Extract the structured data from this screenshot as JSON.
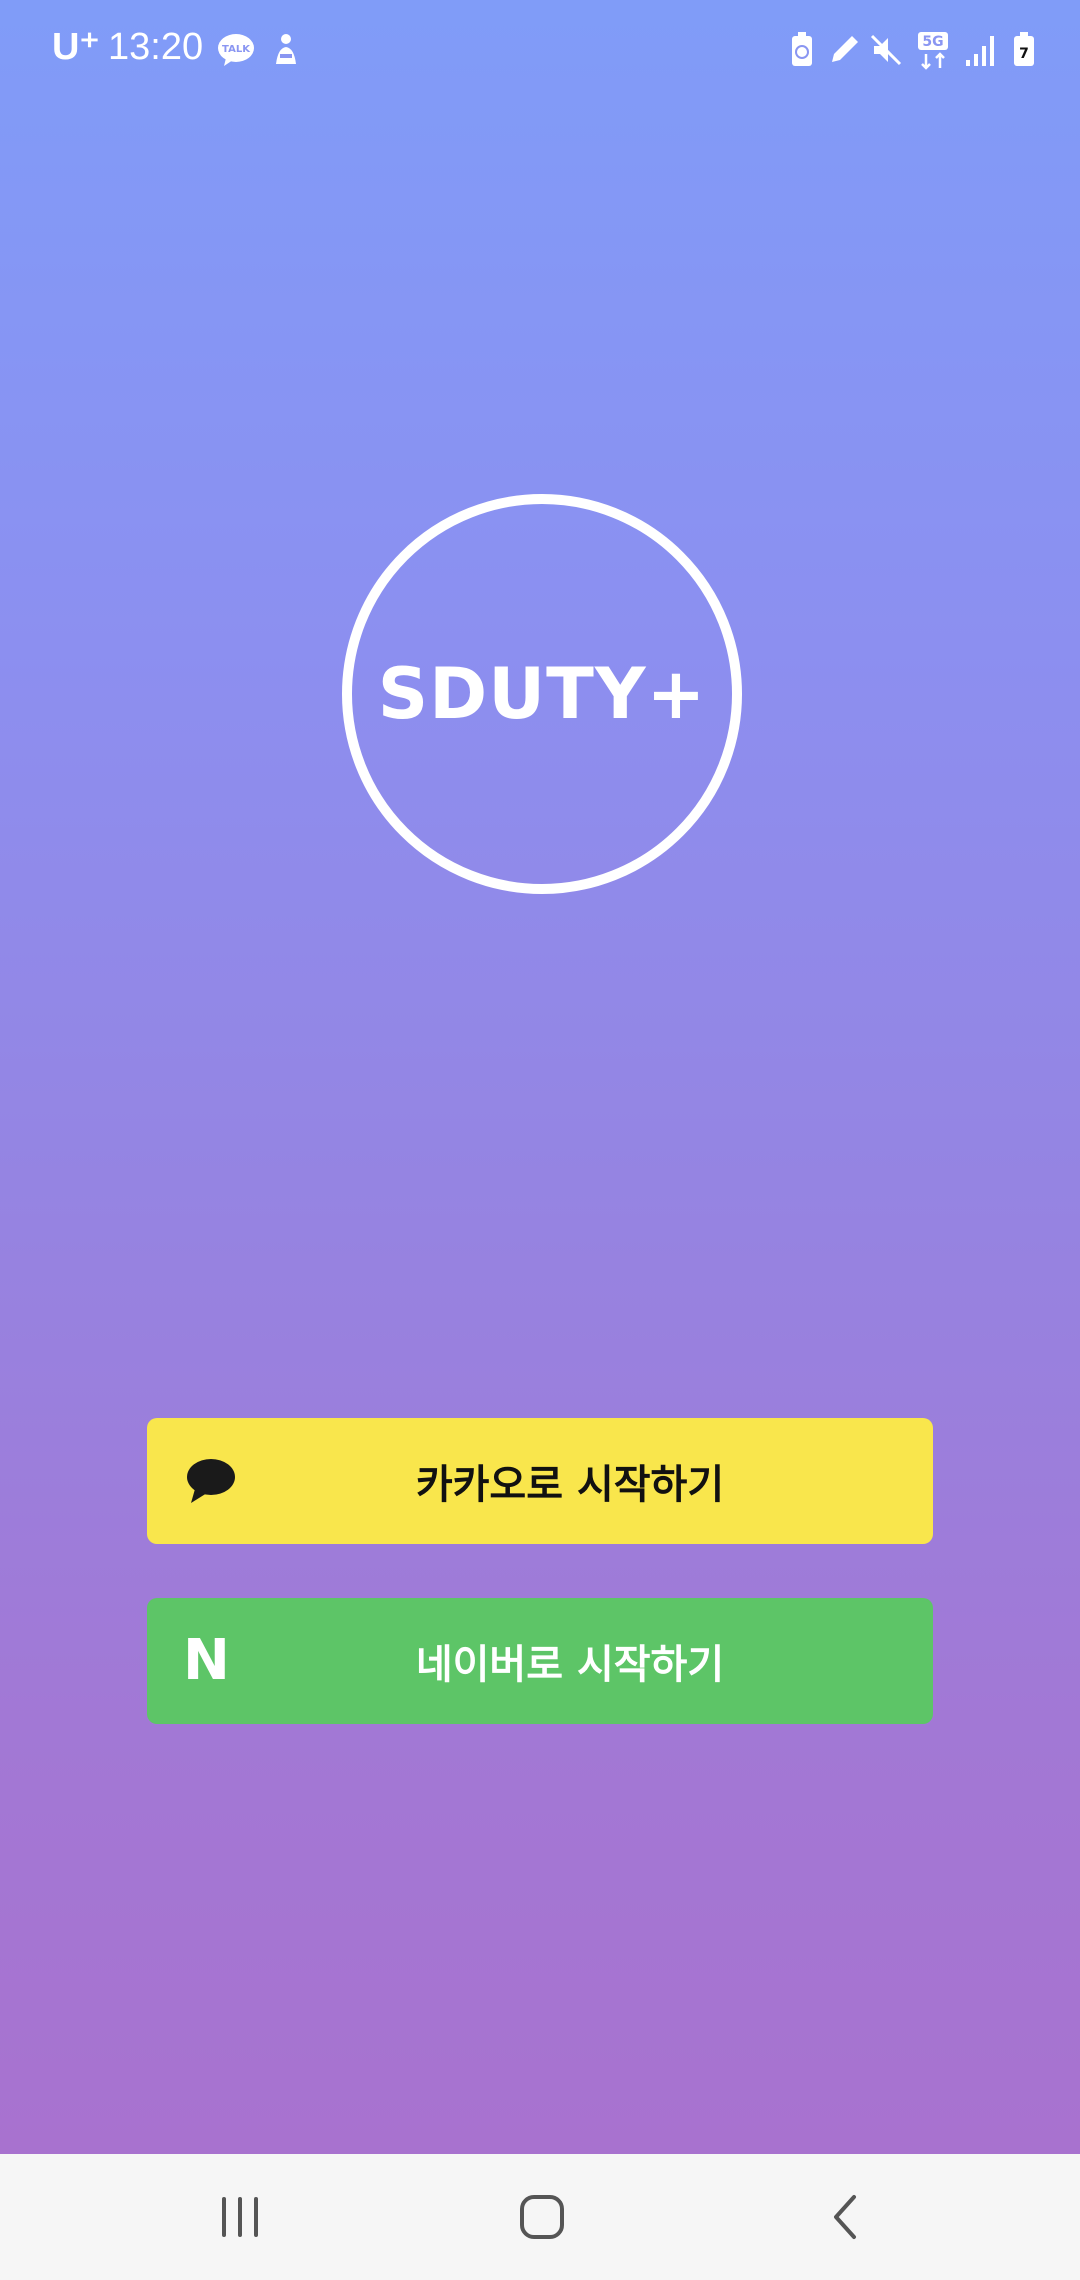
{
  "status_bar": {
    "carrier": "U⁺",
    "time": "13:20",
    "left_icons": [
      "kakaotalk-talk-icon",
      "person-notification-icon"
    ],
    "right_icons": [
      "battery-saver-icon",
      "pen-icon",
      "mute-icon",
      "5g-data-icon",
      "signal-icon",
      "battery-icon"
    ],
    "network_label": "5G"
  },
  "logo": {
    "text": "SDUTY+"
  },
  "buttons": {
    "kakao": {
      "label": "카카오로 시작하기",
      "icon": "kakao-speech-bubble-icon",
      "color": "#f9e64c"
    },
    "naver": {
      "label": "네이버로 시작하기",
      "icon": "naver-n-icon",
      "icon_text": "N",
      "color": "#5dc567"
    }
  },
  "nav_bar": {
    "items": [
      "recent-apps-icon",
      "home-icon",
      "back-icon"
    ]
  }
}
